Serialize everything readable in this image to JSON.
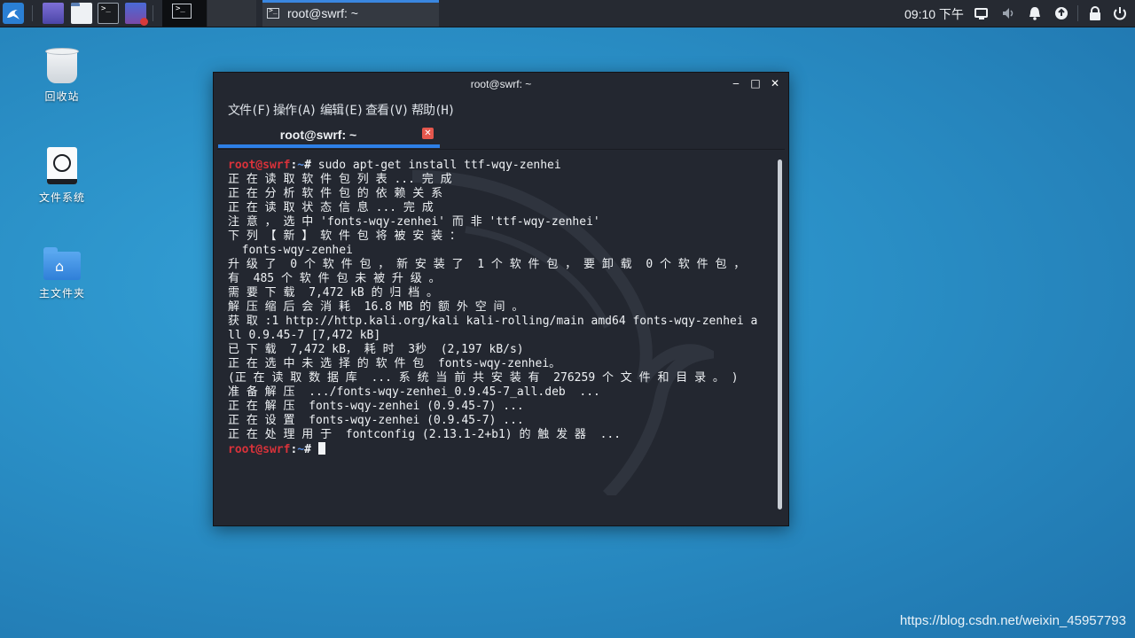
{
  "panel": {
    "app_menu_icon": "kali-dragon-icon",
    "launchers": [
      "workspace-app-icon",
      "file-manager-icon",
      "terminal-icon",
      "screen-recorder-icon"
    ],
    "terminal_glyph": ">_",
    "task_button_label": "root@swrf: ~",
    "clock": "09:10 下午",
    "tray_icons": [
      "display-icon",
      "volume-icon",
      "notification-bell-icon",
      "update-icon",
      "lock-icon",
      "power-icon"
    ]
  },
  "desktop": {
    "icons": [
      {
        "label": "回收站",
        "icon": "trash-icon"
      },
      {
        "label": "文件系统",
        "icon": "drive-icon"
      },
      {
        "label": "主文件夹",
        "icon": "home-folder-icon"
      }
    ]
  },
  "window": {
    "title": "root@swrf: ~",
    "controls": {
      "minimize": "‒",
      "maximize": "□",
      "close": "✕"
    },
    "menus": [
      "文件(F)",
      "操作(A)",
      "编辑(E)",
      "查看(V)",
      "帮助(H)"
    ],
    "tab_label": "root@swrf: ~",
    "tab_close": "✕"
  },
  "terminal": {
    "prompt_user": "root@swrf",
    "prompt_colon": ":",
    "prompt_path": "~",
    "prompt_hash": "#",
    "command": " sudo apt-get install ttf-wqy-zenhei",
    "output": "正 在 读 取 软 件 包 列 表 ... 完 成\n正 在 分 析 软 件 包 的 依 赖 关 系\n正 在 读 取 状 态 信 息 ... 完 成\n注 意 ， 选 中 'fonts-wqy-zenhei' 而 非 'ttf-wqy-zenhei'\n下 列 【 新 】 软 件 包 将 被 安 装 ：\n  fonts-wqy-zenhei\n升 级 了  0 个 软 件 包 ， 新 安 装 了  1 个 软 件 包 ， 要 卸 载  0 个 软 件 包 ， 有  485 个 软 件 包 未 被 升 级 。\n需 要 下 载  7,472 kB 的 归 档 。\n解 压 缩 后 会 消 耗  16.8 MB 的 额 外 空 间 。\n获 取 :1 http://http.kali.org/kali kali-rolling/main amd64 fonts-wqy-zenhei all 0.9.45-7 [7,472 kB]\n已 下 载  7,472 kB， 耗 时  3秒  (2,197 kB/s)\n正 在 选 中 未 选 择 的 软 件 包  fonts-wqy-zenhei。\n(正 在 读 取 数 据 库  ... 系 统 当 前 共 安 装 有  276259 个 文 件 和 目 录 。 )\n准 备 解 压  .../fonts-wqy-zenhei_0.9.45-7_all.deb  ...\n正 在 解 压  fonts-wqy-zenhei (0.9.45-7) ...\n正 在 设 置  fonts-wqy-zenhei (0.9.45-7) ...\n正 在 处 理 用 于  fontconfig (2.13.1-2+b1) 的 触 发 器  ..."
  },
  "credit": "https://blog.csdn.net/weixin_45957793",
  "colors": {
    "desktop_blue": "#2a8fc6",
    "panel": "#262a32",
    "terminal_bg": "#232730",
    "prompt_red": "#d8323a",
    "prompt_blue": "#5b8fe0",
    "accent_blue": "#2d7fe6",
    "tab_close_red": "#e4574d"
  }
}
